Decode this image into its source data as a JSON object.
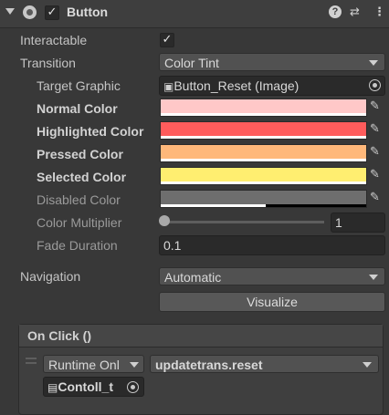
{
  "header": {
    "title": "Button",
    "enabled_check": "✓",
    "icons": [
      "help-icon",
      "presets-icon",
      "kebab-menu-icon"
    ]
  },
  "fields": {
    "interactable": {
      "label": "Interactable",
      "check": "✓"
    },
    "transition": {
      "label": "Transition",
      "value": "Color Tint"
    },
    "target_graphic": {
      "label": "Target Graphic",
      "value": "Button_Reset (Image)"
    },
    "normal_color": {
      "label": "Normal Color",
      "color": "#FFC8C8"
    },
    "highlighted_color": {
      "label": "Highlighted Color",
      "color": "#FF5C5C"
    },
    "pressed_color": {
      "label": "Pressed Color",
      "color": "#FFB87A"
    },
    "selected_color": {
      "label": "Selected Color",
      "color": "#FFEE70"
    },
    "disabled_color": {
      "label": "Disabled Color",
      "color": "#6E6E6E"
    },
    "color_multiplier": {
      "label": "Color Multiplier",
      "value": "1"
    },
    "fade_duration": {
      "label": "Fade Duration",
      "value": "0.1"
    },
    "navigation": {
      "label": "Navigation",
      "value": "Automatic"
    },
    "visualize": {
      "label": "Visualize"
    }
  },
  "on_click": {
    "title": "On Click ()",
    "runtime": "Runtime Onl",
    "function": "updatetrans.reset",
    "target_object": "Contoll_t"
  }
}
